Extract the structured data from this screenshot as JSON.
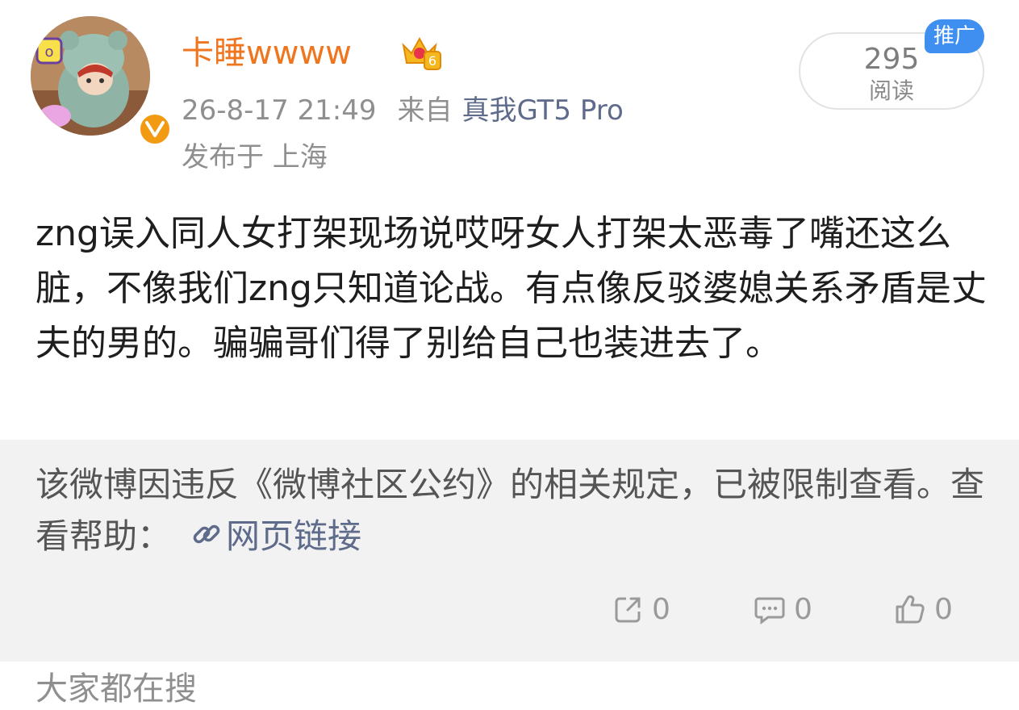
{
  "post": {
    "username": "卡睡wwww",
    "member_level": "6",
    "timestamp": "26-8-17 21:49",
    "source_prefix": "来自",
    "device": "真我GT5 Pro",
    "location": "发布于 上海",
    "read_count": "295",
    "read_label": "阅读",
    "promo_label": "推广",
    "content": "zng误入同人女打架现场说哎呀女人打架太恶毒了嘴还这么脏，不像我们zng只知道论战。有点像反驳婆媳关系矛盾是丈夫的男的。骗骗哥们得了别给自己也装进去了。"
  },
  "notice": {
    "text": "该微博因违反《微博社区公约》的相关规定，已被限制查看。查看帮助：",
    "link_label": "网页链接"
  },
  "actions": {
    "repost_count": "0",
    "comment_count": "0",
    "like_count": "0"
  },
  "section": {
    "title": "大家都在搜"
  },
  "colors": {
    "username": "#f0751f",
    "link": "#5e6b8a",
    "promo_tag": "#3f8ff0",
    "verified_badge": "#f29b12"
  },
  "icons": [
    "verified-icon",
    "crown-icon",
    "link-icon",
    "repost-icon",
    "comment-icon",
    "like-icon"
  ]
}
